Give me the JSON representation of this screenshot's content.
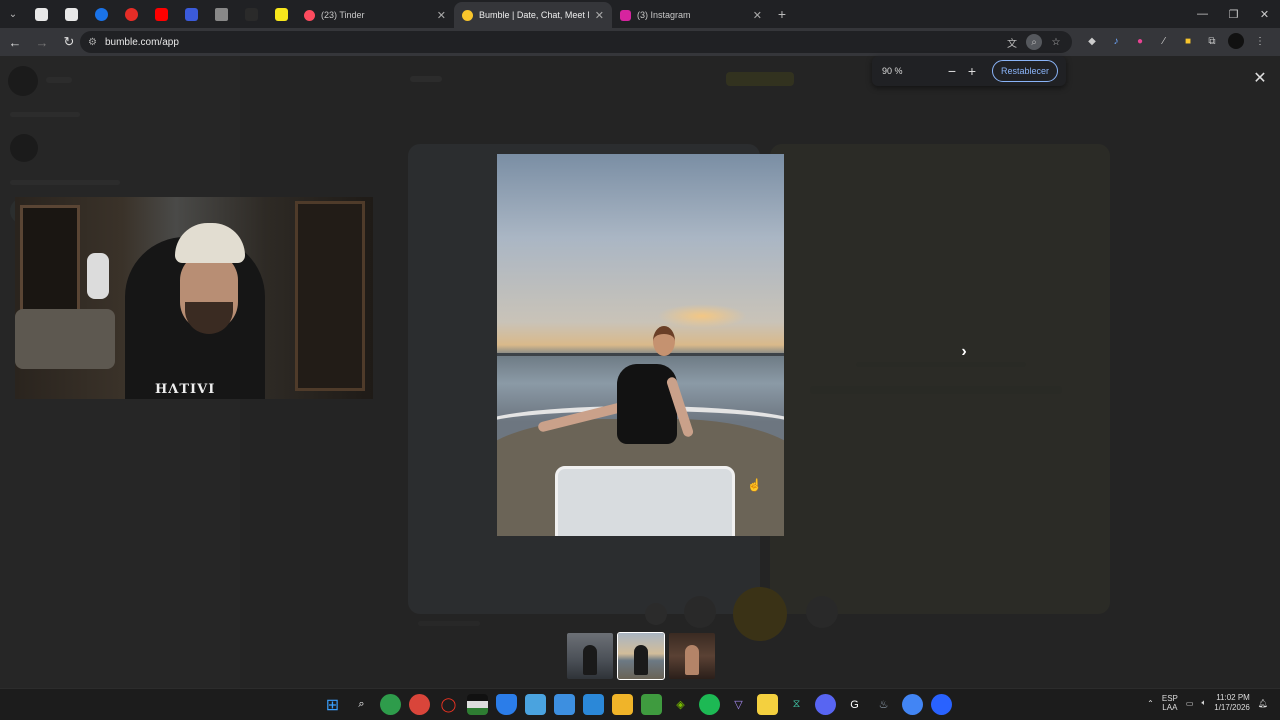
{
  "browser": {
    "tabs": [
      {
        "title": "(23) Tinder",
        "color": "#fd4b5e",
        "active": false
      },
      {
        "title": "Bumble | Date, Chat, Meet New",
        "color": "#f8c52c",
        "active": true
      },
      {
        "title": "(3) Instagram",
        "color": "#d6249f",
        "active": false
      }
    ],
    "pinned_colors": [
      "#e8e8e8",
      "#e8e8e8",
      "#1a73e8",
      "#e52d27",
      "#ff0000",
      "#3b5bdb",
      "#e8e8e8",
      "#3a3a3a",
      "#f8e71c"
    ],
    "new_tab": "+",
    "url": "bumble.com/app"
  },
  "zoom_popup": {
    "level": "90 %",
    "minus": "−",
    "plus": "+",
    "reset_label": "Restablecer"
  },
  "viewer": {
    "close": "✕",
    "next": "›",
    "thumbnails": [
      "photo-1",
      "photo-2",
      "photo-3"
    ],
    "selected_index": 1
  },
  "webcam": {
    "shirt_print": "HΛTIVI"
  },
  "taskbar": {
    "language": "ESP",
    "language_sub": "LAA",
    "time": "11:02 PM",
    "date": "1/17/2026"
  },
  "colors": {
    "accent_blue": "#8ab4f8",
    "bumble_yellow": "#f8c52c"
  }
}
